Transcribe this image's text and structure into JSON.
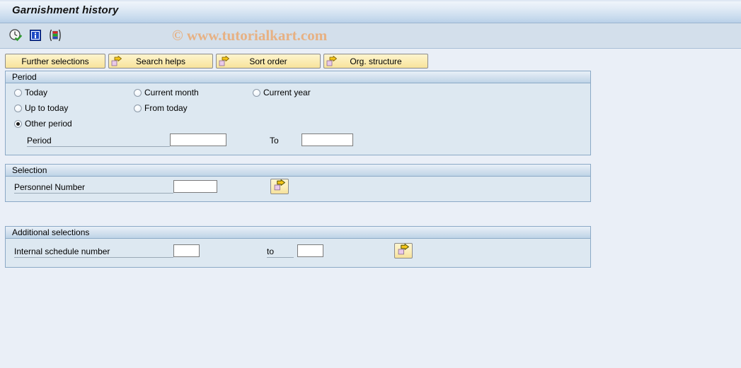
{
  "window": {
    "title": "Garnishment history"
  },
  "toolbar": {
    "icons": [
      {
        "name": "execute-clock-icon",
        "title": "Execute"
      },
      {
        "name": "info-icon",
        "title": "Information"
      },
      {
        "name": "variant-icon",
        "title": "Get variant"
      }
    ],
    "watermark": "© www.tutorialkart.com"
  },
  "buttons": [
    {
      "label": "Further selections",
      "icon": null
    },
    {
      "label": "Search helps",
      "icon": "arrow-right-icon"
    },
    {
      "label": "Sort order",
      "icon": "arrow-right-icon"
    },
    {
      "label": "Org. structure",
      "icon": "arrow-right-icon"
    }
  ],
  "period": {
    "header": "Period",
    "options": [
      {
        "label": "Today",
        "checked": false
      },
      {
        "label": "Current month",
        "checked": false
      },
      {
        "label": "Current year",
        "checked": false
      },
      {
        "label": "Up to today",
        "checked": false
      },
      {
        "label": "From today",
        "checked": false
      },
      {
        "label": "Other period",
        "checked": true
      }
    ],
    "period_label": "Period",
    "period_value": "",
    "to_label": "To",
    "to_value": ""
  },
  "selection": {
    "header": "Selection",
    "personnel_number_label": "Personnel Number",
    "personnel_number_value": "",
    "multiple_selection_icon": "multiple-selection-icon"
  },
  "additional": {
    "header": "Additional selections",
    "schedule_label": "Internal schedule number",
    "schedule_from_value": "",
    "to_label": "to",
    "schedule_to_value": "",
    "multiple_selection_icon": "multiple-selection-icon"
  },
  "colors": {
    "page_background": "#eaeff7",
    "panel_background": "#dde8f1",
    "panel_border": "#8ba9c6",
    "titlebar_accent": "#b9d0e8",
    "button_yellow": "#fbecb4",
    "watermark": "#e7b183"
  }
}
